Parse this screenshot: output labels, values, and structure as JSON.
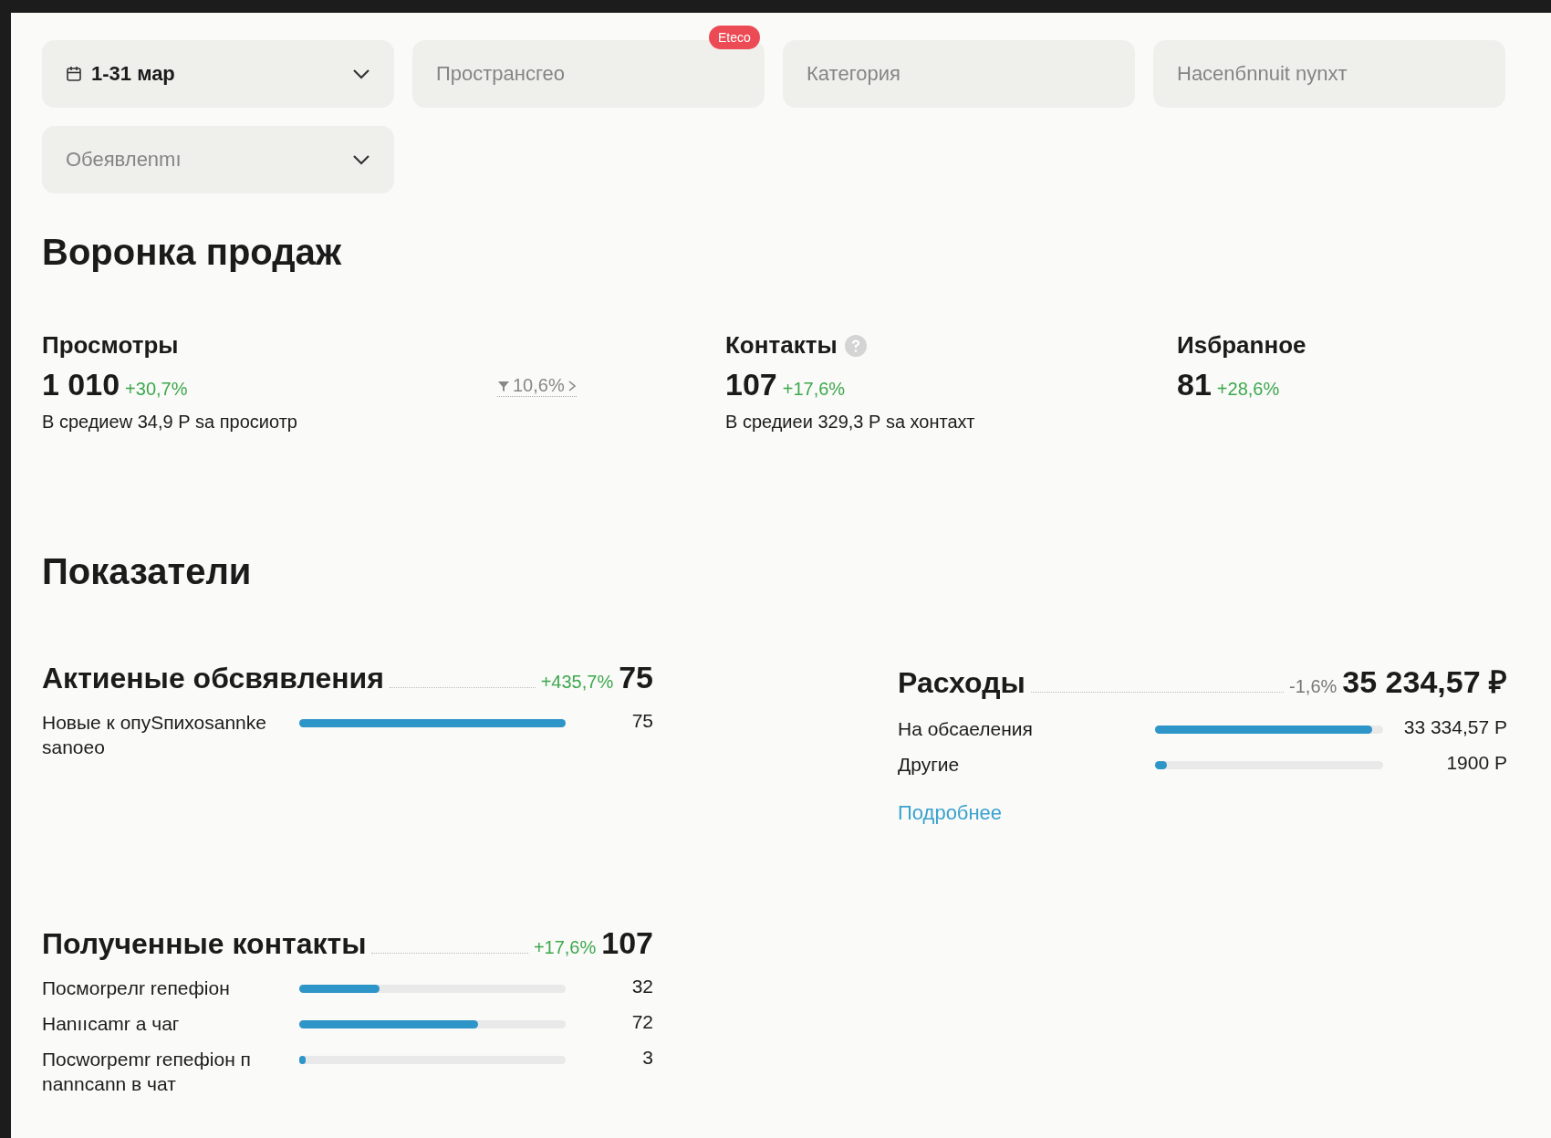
{
  "filters": [
    {
      "kind": "date",
      "value": "1-31 мар",
      "dropdown": true
    },
    {
      "kind": "text",
      "placeholder": "Пространсгео",
      "badge": "Eteco",
      "dropdown": false
    },
    {
      "kind": "text",
      "placeholder": "Категория",
      "dropdown": false
    },
    {
      "kind": "text",
      "placeholder": "Hacenбnnuit nynxт",
      "dropdown": false
    },
    {
      "kind": "select",
      "placeholder": "Обеявлenmı",
      "dropdown": true
    }
  ],
  "funnel": {
    "title": "Воронка продаж",
    "metrics": [
      {
        "label": "Просмотры",
        "value": "1 010",
        "change": "+30,7%",
        "note": "В средиеw 34,9 Р sa просиотр",
        "help": false
      },
      {
        "label": "Контакты",
        "value": "107",
        "change": "+17,6%",
        "note": "В средиеи 329,3 Р sa хонтахт",
        "help": true
      },
      {
        "label": "Иsбрanное",
        "value": "81",
        "change": "+28,6%",
        "help": false
      }
    ],
    "conversion": "10,6%"
  },
  "indicators": {
    "title": "Показатели",
    "sections": [
      {
        "title": "Актиеные обсвявления",
        "change": "+435,7%",
        "positive": true,
        "total": "75",
        "rows": [
          {
            "label": "Новые к опуSпихоsannke sanoeo",
            "level": 1.0,
            "value": "75"
          }
        ]
      },
      {
        "title": "Расходы",
        "change": "-1,6%",
        "positive": false,
        "total": "35 234,57 ₽",
        "rows": [
          {
            "label": "На обсаеления",
            "level": 0.95,
            "value": "33 334,57 Р"
          },
          {
            "label": "Другие",
            "level": 0.05,
            "value": "1900 Р"
          }
        ],
        "link": "Подробнее"
      },
      {
        "title": "Полученные контакты",
        "change": "+17,6%",
        "positive": true,
        "total": "107",
        "rows": [
          {
            "label": "Посмоrpeлr reпeфioн",
            "level": 0.3,
            "value": "32"
          },
          {
            "label": "Hanııcamr a чаг",
            "level": 0.67,
            "value": "72"
          },
          {
            "label": "Посwоrpemr reпeфioн п nanncann в чат",
            "level": 0.02,
            "value": "3"
          }
        ]
      }
    ]
  }
}
